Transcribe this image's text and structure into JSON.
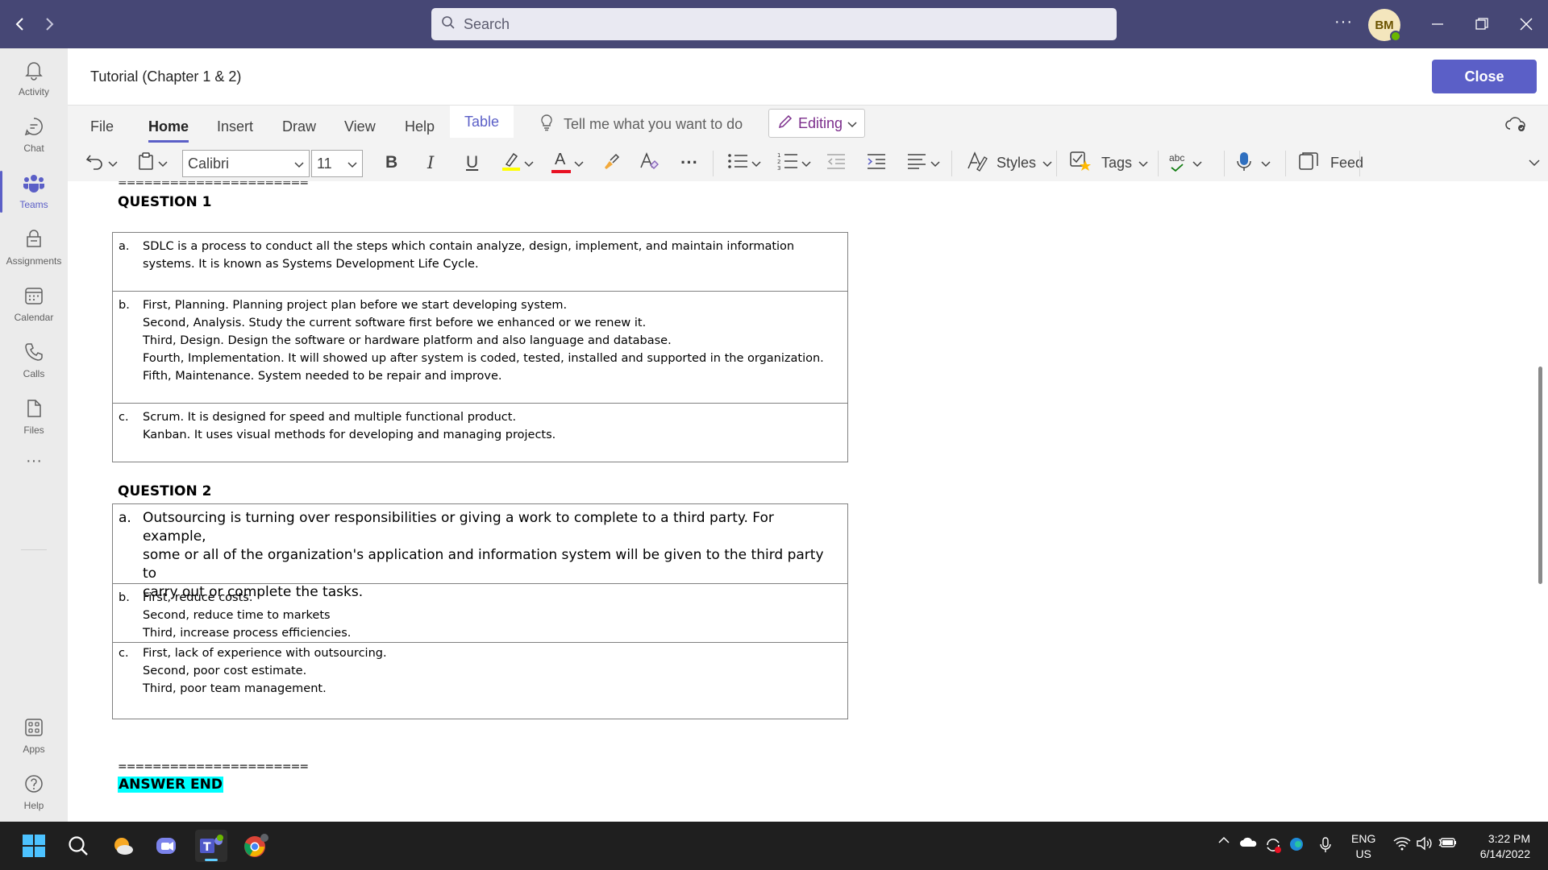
{
  "titlebar": {
    "search_placeholder": "Search",
    "more_label": "···",
    "avatar_initials": "BM"
  },
  "rail": {
    "items": [
      {
        "label": "Activity",
        "icon": "bell-icon"
      },
      {
        "label": "Chat",
        "icon": "chat-icon"
      },
      {
        "label": "Teams",
        "icon": "teams-icon",
        "active": true
      },
      {
        "label": "Assignments",
        "icon": "assignments-icon"
      },
      {
        "label": "Calendar",
        "icon": "calendar-icon"
      },
      {
        "label": "Calls",
        "icon": "phone-icon"
      },
      {
        "label": "Files",
        "icon": "file-icon"
      }
    ],
    "more_label": "···",
    "apps_label": "Apps",
    "help_label": "Help"
  },
  "document": {
    "title": "Tutorial (Chapter 1 & 2)",
    "close_label": "Close"
  },
  "ribbon": {
    "tabs": [
      "File",
      "Home",
      "Insert",
      "Draw",
      "View",
      "Help",
      "Table"
    ],
    "active_tab": "Home",
    "tell_me": "Tell me what you want to do",
    "editing_label": "Editing",
    "font_name": "Calibri",
    "font_size": "11",
    "bold": "B",
    "italic": "I",
    "underline": "U",
    "font_color_letter": "A",
    "styles_label": "Styles",
    "tags_label": "Tags",
    "spelling_label": "abc",
    "feed_label": "Feed",
    "more_label": "···"
  },
  "content": {
    "separator_top": "======================",
    "question1": {
      "heading": "QUESTION 1",
      "rows": [
        {
          "label": "a.",
          "lines": [
            "SDLC is a process to conduct all the steps which contain analyze, design, implement, and maintain information",
            "systems. It is known as Systems Development Life Cycle."
          ]
        },
        {
          "label": "b.",
          "lines": [
            "First, Planning. Planning project plan before we start developing system.",
            "Second, Analysis. Study the current software first before we enhanced or we renew it.",
            "Third, Design. Design the software or hardware platform and also language and database.",
            "Fourth, Implementation. It will showed up after system is coded, tested, installed and supported in the organization.",
            "Fifth, Maintenance. System needed to be repair and improve."
          ]
        },
        {
          "label": "c.",
          "lines": [
            "Scrum. It is designed for speed and multiple functional product.",
            "Kanban. It uses visual methods for developing and managing projects."
          ]
        }
      ]
    },
    "question2": {
      "heading": "QUESTION 2",
      "rows": [
        {
          "label": "a.",
          "lines": [
            "Outsourcing is turning over responsibilities or giving a work to complete to a third party. For example,",
            "some or all of the organization's application and information system will be given to the third party to",
            "carry out or complete the tasks."
          ]
        },
        {
          "label": "b.",
          "lines": [
            "First, reduce costs.",
            "Second, reduce time to markets",
            "Third, increase process efficiencies."
          ]
        },
        {
          "label": "c.",
          "lines": [
            "First, lack of experience with outsourcing.",
            "Second, poor cost estimate.",
            "Third, poor team management."
          ]
        }
      ]
    },
    "separator_bottom": "======================",
    "answer_end": "ANSWER END",
    "highlight_color": "#00ffff"
  },
  "taskbar": {
    "lang_top": "ENG",
    "lang_bottom": "US",
    "time": "3:22 PM",
    "date": "6/14/2022"
  },
  "colors": {
    "titlebar": "#464775",
    "accent": "#5b5fc7",
    "editing": "#7b2d8b"
  }
}
